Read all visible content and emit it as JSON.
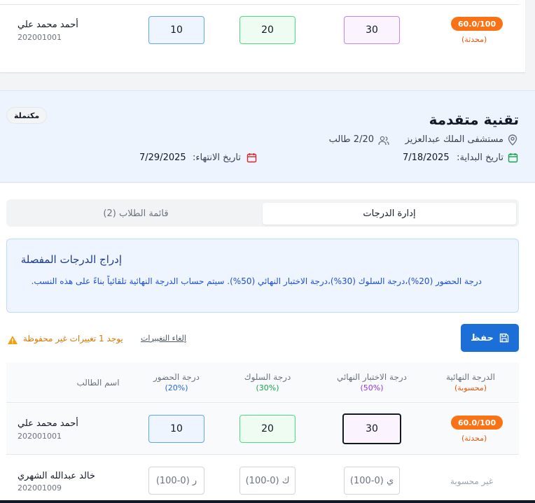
{
  "top_row": {
    "student_name": "أحمد محمد علي",
    "student_id": "202001001",
    "attendance": "10",
    "behavior": "20",
    "final_exam": "30",
    "final_grade": "60.0/100",
    "final_status": "(محدثة)"
  },
  "course": {
    "title": "تقنية متقدمة",
    "status": "مكتملة",
    "hospital": "مستشفى الملك عبدالعزيز",
    "students": "2/20 طالب",
    "start_label": "تاريخ البداية:",
    "start_date": "7/18/2025",
    "end_label": "تاريخ الانتهاء:",
    "end_date": "7/29/2025"
  },
  "tabs": {
    "active": "إدارة الدرجات",
    "inactive": "قائمة الطلاب (2)"
  },
  "info": {
    "title": "إدراج الدرجات المفصلة",
    "description": "درجة الحضور (20%)،درجة السلوك (30%)،درجة الاختبار النهائي (50%). سيتم حساب الدرجة النهائية تلقائياً بناءً على هذه النسب."
  },
  "actions": {
    "save_label": "حفظ",
    "cancel_label": "إلغاء التغييرات",
    "unsaved_label": "يوجد 1 تغييرات غير محفوظة"
  },
  "table": {
    "headers": {
      "final_grade": "الدرجة النهائية",
      "final_grade_sub": "(محسوبة)",
      "final_exam": "درجة الاختبار النهائي",
      "final_exam_sub": "(50%)",
      "behavior": "درجة السلوك",
      "behavior_sub": "(30%)",
      "attendance": "درجة الحضور",
      "attendance_sub": "(20%)",
      "student": "اسم الطالب"
    },
    "rows": [
      {
        "student_name": "أحمد محمد علي",
        "student_id": "202001001",
        "attendance": "10",
        "behavior": "20",
        "final_exam": "30",
        "final_grade": "60.0/100",
        "final_status": "(محدثة)"
      },
      {
        "student_name": "خالد عبدالله الشهري",
        "student_id": "202001009",
        "attendance_placeholder": "ر (0-100)",
        "behavior_placeholder": "ك (0-100)",
        "final_exam_placeholder": "ي (0-100)",
        "final_grade": "غير محسوبة"
      }
    ]
  },
  "colors": {
    "primary": "#1d6fd8",
    "orange": "#f97316",
    "attendance": "#60a5fa",
    "behavior": "#4ade80",
    "final": "#c084fc",
    "warning": "#d97706"
  },
  "icons": {
    "location": "map-pin-icon",
    "users": "users-icon",
    "calendar": "calendar-icon",
    "save": "floppy-disk-icon",
    "warning": "warning-triangle-icon"
  }
}
